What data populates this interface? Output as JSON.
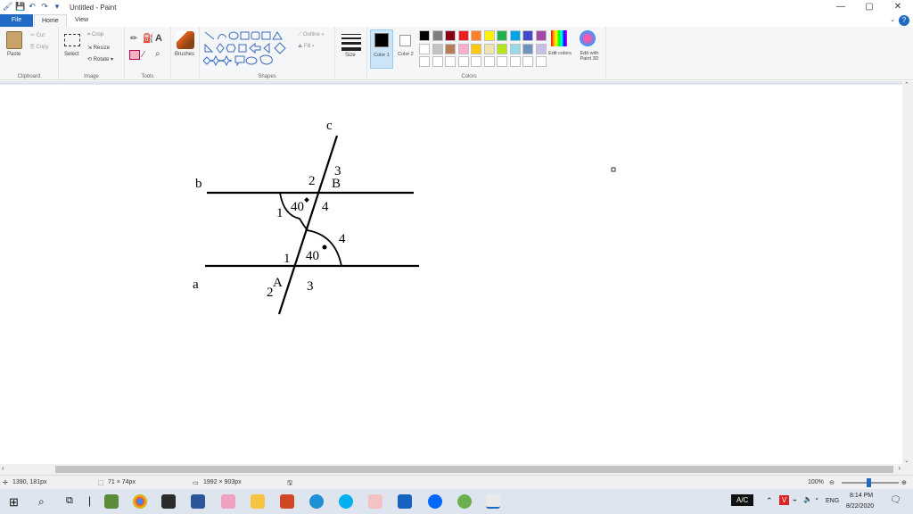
{
  "window": {
    "title": "Untitled - Paint",
    "minimize": "—",
    "maximize": "▢",
    "close": "✕"
  },
  "tabs": {
    "file": "File",
    "home": "Home",
    "view": "View"
  },
  "ribbon": {
    "clipboard": {
      "label": "Clipboard",
      "paste": "Paste",
      "cut": "Cut",
      "copy": "Copy"
    },
    "image": {
      "label": "Image",
      "select": "Select",
      "crop": "Crop",
      "resize": "Resize",
      "rotate": "Rotate"
    },
    "tools": {
      "label": "Tools"
    },
    "brushes": {
      "label": "Brushes"
    },
    "shapes": {
      "label": "Shapes",
      "outline": "Outline",
      "fill": "Fill"
    },
    "size": {
      "label": "Size"
    },
    "colors": {
      "label": "Colors",
      "color1": "Color 1",
      "color2": "Color 2",
      "edit_colors": "Edit colors",
      "edit_paint3d": "Edit with Paint 3D",
      "palette": [
        "#000000",
        "#7f7f7f",
        "#880015",
        "#ed1c24",
        "#ff7f27",
        "#fff200",
        "#22b14c",
        "#00a2e8",
        "#3f48cc",
        "#a349a4",
        "#ffffff",
        "#c3c3c3",
        "#b97a57",
        "#ffaec9",
        "#ffc90e",
        "#efe4b0",
        "#b5e61d",
        "#99d9ea",
        "#7092be",
        "#c8bfe7"
      ]
    }
  },
  "drawing": {
    "labels": {
      "c": "c",
      "b": "b",
      "a": "a",
      "B": "B",
      "A": "A",
      "b_2": "2",
      "b_3": "3",
      "b_1": "1",
      "b_4": "4",
      "b_40": "40",
      "a_1": "1",
      "a_4": "4",
      "a_2": "2",
      "a_3": "3",
      "a_40": "40"
    }
  },
  "status": {
    "cursor": "1390, 181px",
    "selection": "71 × 74px",
    "canvas_size": "1992 × 903px",
    "zoom": "100%"
  },
  "taskbar": {
    "tray_ac": "A/C",
    "lang": "ENG",
    "time": "8:14 PM",
    "date": "8/22/2020"
  }
}
